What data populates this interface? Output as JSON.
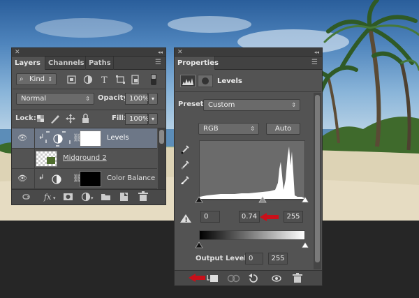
{
  "layers_panel": {
    "tabs": [
      "Layers",
      "Channels",
      "Paths"
    ],
    "filter_kind": "Kind",
    "blend_mode": "Normal",
    "opacity_label": "Opacity:",
    "opacity_value": "100%",
    "lock_label": "Lock:",
    "fill_label": "Fill:",
    "fill_value": "100%",
    "layers": [
      {
        "name": "Levels",
        "selected": true
      },
      {
        "name": "Midground 2",
        "selected": false
      },
      {
        "name": "Color Balance",
        "selected": false
      }
    ]
  },
  "properties_panel": {
    "tab": "Properties",
    "adjustment_name": "Levels",
    "preset_label": "Preset:",
    "preset_value": "Custom",
    "channel_value": "RGB",
    "auto_label": "Auto",
    "input_black": "0",
    "input_gamma": "0.74",
    "input_white": "255",
    "output_levels_label": "Output Levels:",
    "output_black": "0",
    "output_white": "255"
  },
  "colors": {
    "panel": "#535353",
    "selected_layer": "#6d7787",
    "annotation_arrow": "#c8101a"
  }
}
